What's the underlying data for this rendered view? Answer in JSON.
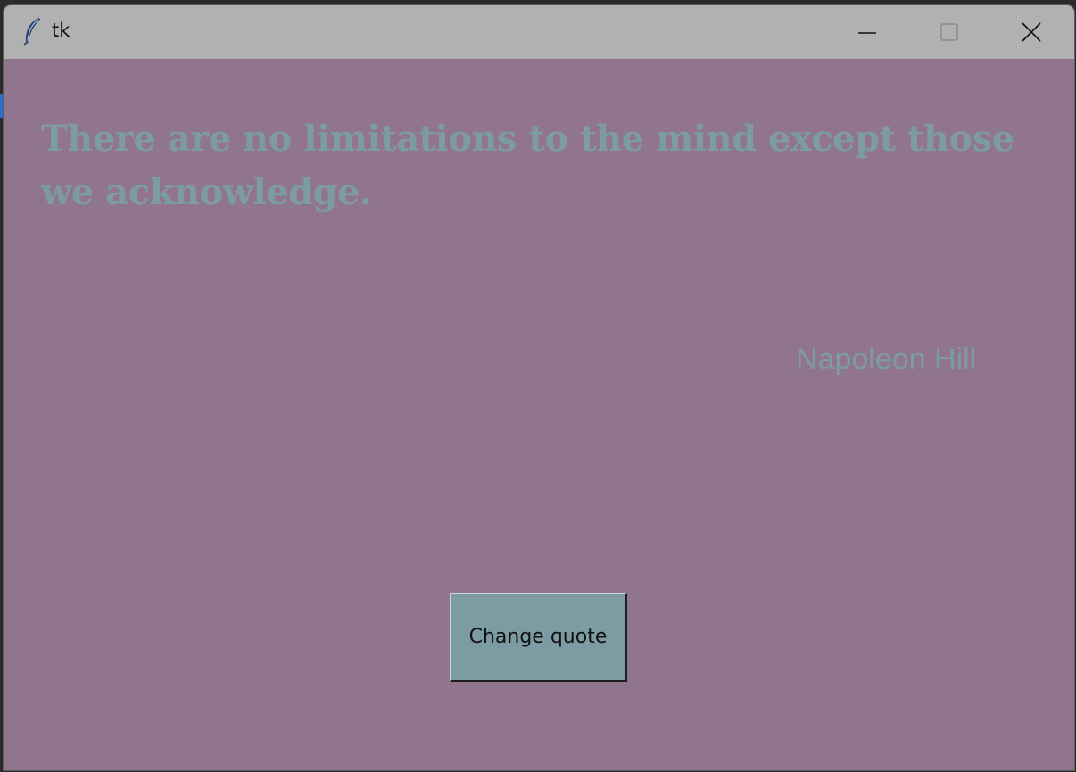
{
  "window": {
    "title": "tk",
    "controls": {
      "minimize_icon": "minimize-icon",
      "maximize_icon": "maximize-icon",
      "close_icon": "close-icon"
    }
  },
  "quote": {
    "text": "There are no limitations to the mind except those we acknowledge.",
    "author": "Napoleon Hill"
  },
  "button": {
    "label": "Change quote"
  },
  "colors": {
    "background": "#91748e",
    "text": "#7c9ba3",
    "button_bg": "#7c9ba3",
    "titlebar": "#b1b1b1"
  }
}
